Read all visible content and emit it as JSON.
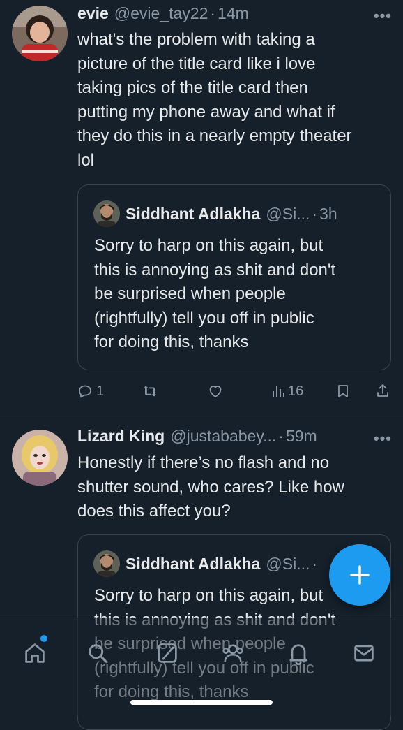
{
  "tweets": [
    {
      "name": "evie",
      "handle": "@evie_tay22",
      "separator": "·",
      "time": "14m",
      "more": "•••",
      "text": "what's the problem with taking a\npicture of the title card like i love\ntaking pics of the title card then\nputting my phone away and what if\nthey do this in a nearly empty theater\nlol",
      "quote": {
        "name": "Siddhant Adlakha",
        "handle": "@Si...",
        "separator": "·",
        "time": "3h",
        "text": "Sorry to harp on this again, but\nthis is annoying as shit and don't\nbe surprised when people\n(rightfully) tell you off in public\nfor doing this, thanks"
      },
      "actions": {
        "reply_count": "1",
        "retweet_count": "",
        "like_count": "",
        "views_count": "16"
      }
    },
    {
      "name": "Lizard King",
      "handle": "@justababey...",
      "separator": "·",
      "time": "59m",
      "more": "•••",
      "text": "Honestly if there’s no flash and no\nshutter sound, who cares? Like how\ndoes this affect you?",
      "quote": {
        "name": "Siddhant Adlakha",
        "handle": "@Si...",
        "separator": "·",
        "time": "",
        "text": "Sorry to harp on this again, but\nthis is annoying as shit and don't\nbe surprised when people\n(rightfully) tell you off in public\nfor doing this, thanks"
      }
    }
  ],
  "colors": {
    "background": "#15202b",
    "accent": "#1d9bf0",
    "secondary_text": "#8b98a5",
    "border": "#38444d"
  },
  "icons": {
    "compose": "plus-icon",
    "tabs": [
      "home-icon",
      "search-icon",
      "grok-icon",
      "communities-icon",
      "notifications-icon",
      "messages-icon"
    ]
  }
}
